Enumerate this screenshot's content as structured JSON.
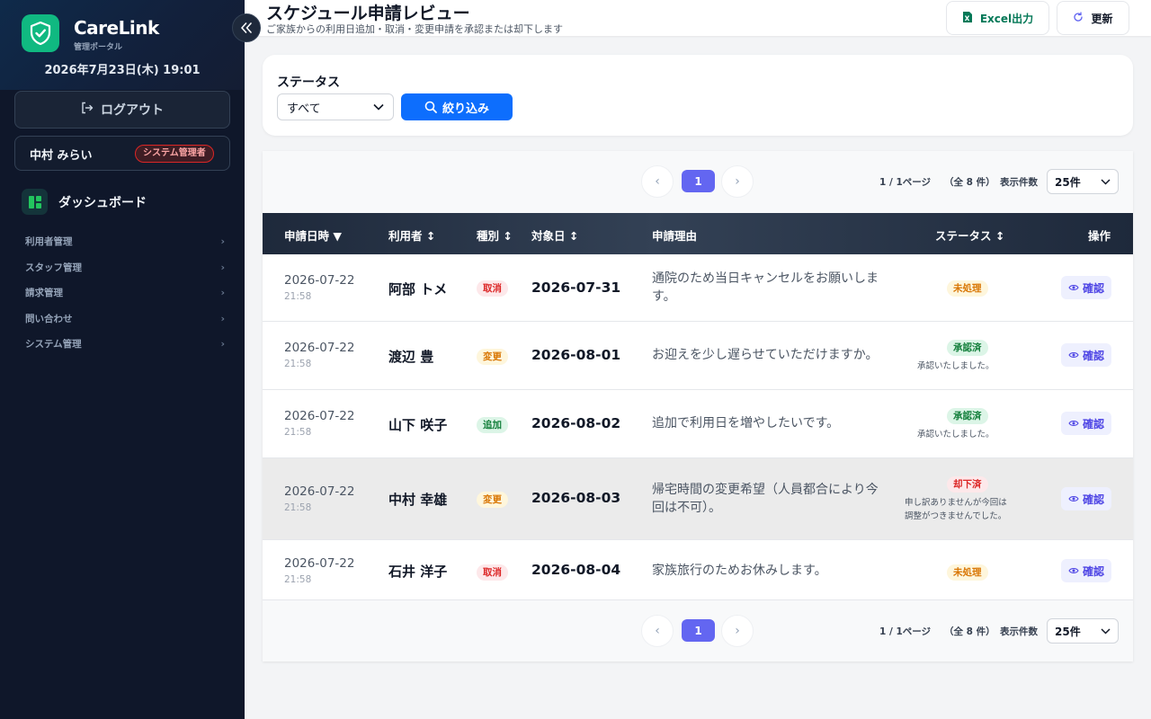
{
  "sidebar": {
    "brand": "CareLink",
    "brand_sub": "管理ポータル",
    "datetime": "2026年7月23日(木) 19:01",
    "logout_label": "ログアウト",
    "user_name": "中村 みらい",
    "user_role": "システム管理者",
    "dashboard_label": "ダッシュボード",
    "nav": [
      "利用者管理",
      "スタッフ管理",
      "請求管理",
      "問い合わせ",
      "システム管理"
    ]
  },
  "header": {
    "title": "スケジュール申請レビュー",
    "subtitle": "ご家族からの利用日追加・取消・変更申請を承認または却下します",
    "excel_label": "Excel出力",
    "refresh_label": "更新"
  },
  "filter": {
    "label": "ステータス",
    "selected": "すべて",
    "button_label": "絞り込み"
  },
  "pagination": {
    "current_page": "1",
    "page_info": "1 / 1ページ",
    "total_info": "（全 8 件）",
    "page_size_label": "表示件数",
    "page_size": "25件"
  },
  "table": {
    "columns": [
      "申請日時 ▼",
      "利用者 ↕",
      "種別 ↕",
      "対象日 ↕",
      "申請理由",
      "ステータス ↕",
      "操作"
    ],
    "action_label": "確認",
    "rows": [
      {
        "date": "2026-07-22",
        "time": "21:58",
        "user": "阿部 トメ",
        "type": "取消",
        "target": "2026-07-31",
        "reason": "通院のため当日キャンセルをお願いします。",
        "status": "未処理",
        "note": ""
      },
      {
        "date": "2026-07-22",
        "time": "21:58",
        "user": "渡辺 豊",
        "type": "変更",
        "target": "2026-08-01",
        "reason": "お迎えを少し遅らせていただけますか。",
        "status": "承認済",
        "note": "承認いたしました。"
      },
      {
        "date": "2026-07-22",
        "time": "21:58",
        "user": "山下 咲子",
        "type": "追加",
        "target": "2026-08-02",
        "reason": "追加で利用日を増やしたいです。",
        "status": "承認済",
        "note": "承認いたしました。"
      },
      {
        "date": "2026-07-22",
        "time": "21:58",
        "user": "中村 幸雄",
        "type": "変更",
        "target": "2026-08-03",
        "reason": "帰宅時間の変更希望（人員都合により今回は不可）。",
        "status": "却下済",
        "note": "申し訳ありませんが今回は",
        "note2": "調整がつきませんでした。"
      },
      {
        "date": "2026-07-22",
        "time": "21:58",
        "user": "石井 洋子",
        "type": "取消",
        "target": "2026-08-04",
        "reason": "家族旅行のためお休みします。",
        "status": "未処理",
        "note": ""
      }
    ]
  },
  "colors": {
    "sidebar_bg": "#0f172a",
    "accent_green": "#10b981",
    "primary_blue": "#0d6efd",
    "page_active": "#6366f1",
    "table_header": "#1e293b"
  }
}
